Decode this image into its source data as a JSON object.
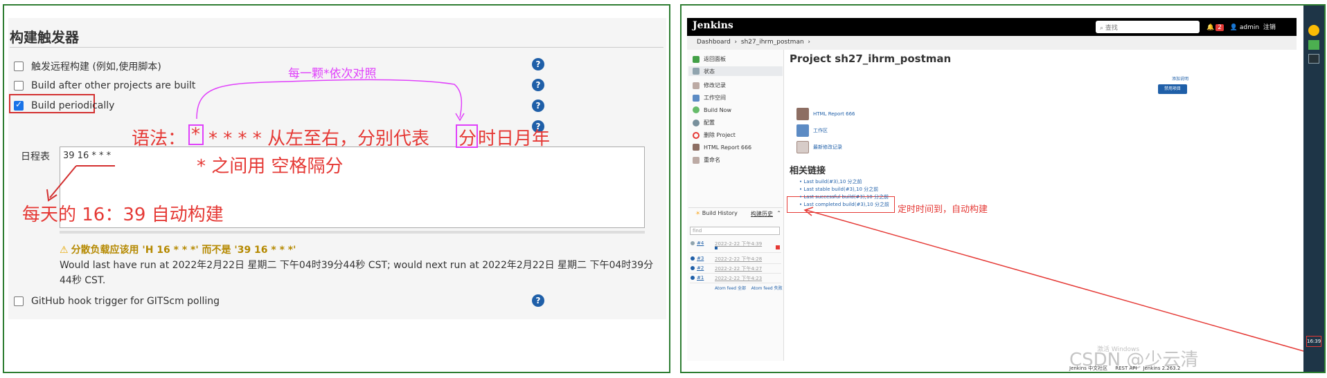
{
  "left_panel": {
    "section_title": "构建触发器",
    "triggers": [
      {
        "label": "触发远程构建 (例如,使用脚本)",
        "checked": false
      },
      {
        "label": "Build after other projects are built",
        "checked": false
      },
      {
        "label": "Build periodically",
        "checked": true
      },
      {
        "label": "GitHub hook trigger for GITScm polling",
        "checked": false
      }
    ],
    "help_glyph": "?",
    "schedule_label": "日程表",
    "schedule_value": "39 16 * * *",
    "warning": "分散负载应该用 'H 16 * * *' 而不是 '39 16 * * *'",
    "warning_icon": "⚠",
    "run_note": "Would last have run at 2022年2月22日 星期二 下午04时39分44秒 CST; would next run at 2022年2月22日 星期二 下午04时39分44秒 CST.",
    "annotations": {
      "syntax_prefix": "语法：",
      "syntax_first_star": "*",
      "syntax_rest": "* * * * 从左至右，分别代表",
      "syntax_fen": "分",
      "syntax_tail": "时日月年",
      "separator": "* 之间用 空格隔分",
      "daily": "每天的 16：39 自动构建",
      "each_star": "每一颗*依次对照"
    }
  },
  "right_panel": {
    "logo": "Jenkins",
    "search_placeholder": "查找",
    "notif_count": "2",
    "user": "admin",
    "logout": "注销",
    "breadcrumbs": [
      "Dashboard",
      "sh27_ihrm_postman"
    ],
    "side_tasks": [
      "返回面板",
      "状态",
      "修改记录",
      "工作空间",
      "Build Now",
      "配置",
      "删除 Project",
      "HTML Report 666",
      "重命名"
    ],
    "build_history_title": "Build History",
    "build_history_trend": "构建历史",
    "filter_placeholder": "find",
    "builds": [
      {
        "num": "#4",
        "date": "2022-2-22 下午4:39"
      },
      {
        "num": "#3",
        "date": "2022-2-22 下午4:28"
      },
      {
        "num": "#2",
        "date": "2022-2-22 下午4:27"
      },
      {
        "num": "#1",
        "date": "2022-2-22 下午4:23"
      }
    ],
    "atom_all": "Atom feed 全部",
    "atom_failed": "Atom feed 失败",
    "project_title": "Project sh27_ihrm_postman",
    "add_desc": "添加说明",
    "disable_btn": "禁用项目",
    "main_links": [
      "HTML Report 666",
      "工作区",
      "最新修改记录"
    ],
    "related_title": "相关链接",
    "related_links": [
      "Last build(#3),10 分之前",
      "Last stable build(#3),10 分之前",
      "Last successful build(#3),10 分之前",
      "Last completed build(#3),10 分之前"
    ],
    "footer": {
      "community": "Jenkins 中文社区",
      "rest": "REST API",
      "version": "Jenkins 2.263.2"
    },
    "annotation": "定时时间到，自动构建",
    "clock": "16:39",
    "windows_watermark": "激活 Windows",
    "csdn_watermark": "CSDN @少云清"
  }
}
